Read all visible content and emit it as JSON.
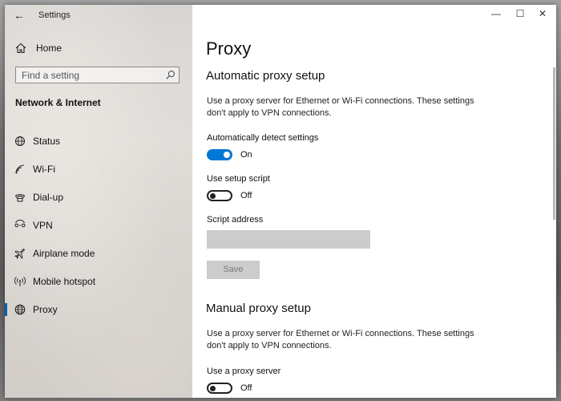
{
  "window": {
    "app_title": "Settings",
    "controls": {
      "minimize": "—",
      "maximize": "☐",
      "close": "✕"
    }
  },
  "sidebar": {
    "home_label": "Home",
    "search_placeholder": "Find a setting",
    "section_title": "Network & Internet",
    "items": [
      {
        "label": "Status",
        "icon": "status-globe-icon"
      },
      {
        "label": "Wi-Fi",
        "icon": "wifi-icon"
      },
      {
        "label": "Dial-up",
        "icon": "dialup-icon"
      },
      {
        "label": "VPN",
        "icon": "vpn-icon"
      },
      {
        "label": "Airplane mode",
        "icon": "airplane-icon"
      },
      {
        "label": "Mobile hotspot",
        "icon": "hotspot-icon"
      },
      {
        "label": "Proxy",
        "icon": "globe-icon",
        "active": true
      }
    ]
  },
  "main": {
    "title": "Proxy",
    "automatic": {
      "heading": "Automatic proxy setup",
      "description": "Use a proxy server for Ethernet or Wi-Fi connections. These settings don't apply to VPN connections.",
      "detect_label": "Automatically detect settings",
      "detect_state": "On",
      "script_label": "Use setup script",
      "script_state": "Off",
      "address_label": "Script address",
      "address_value": "",
      "save_label": "Save"
    },
    "manual": {
      "heading": "Manual proxy setup",
      "description": "Use a proxy server for Ethernet or Wi-Fi connections. These settings don't apply to VPN connections.",
      "use_label": "Use a proxy server",
      "use_state": "Off"
    }
  },
  "colors": {
    "accent": "#0078d7",
    "active_indicator": "#0063b1",
    "disabled_fill": "#cccccc"
  }
}
